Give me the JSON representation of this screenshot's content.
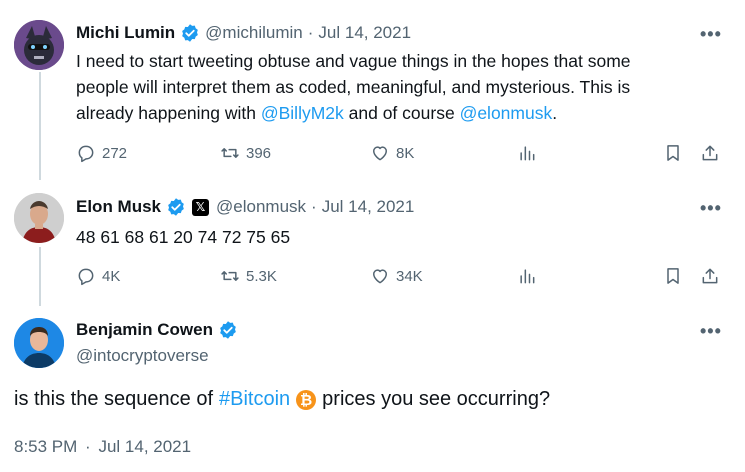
{
  "colors": {
    "accent": "#1d9bf0",
    "muted": "#536471",
    "text": "#0f1419",
    "bitcoin": "#f7931a"
  },
  "tweet1": {
    "name": "Michi Lumin",
    "handle": "@michilumin",
    "sep": "·",
    "date": "Jul 14, 2021",
    "text_a": "I need to start tweeting obtuse and vague things in the hopes that some",
    "text_b": "people will interpret them as coded, meaningful, and mysterious. This is",
    "text_c1": "already happening with ",
    "mention1": "@BillyM2k",
    "text_c2": " and of course ",
    "mention2": "@elonmusk",
    "text_c3": ".",
    "replies": "272",
    "retweets": "396",
    "likes": "8K"
  },
  "tweet2": {
    "name": "Elon Musk",
    "handle": "@elonmusk",
    "sep": "·",
    "date": "Jul 14, 2021",
    "text": "48 61 68 61 20 74 72 75 65",
    "replies": "4K",
    "retweets": "5.3K",
    "likes": "34K"
  },
  "tweet3": {
    "name": "Benjamin Cowen",
    "handle": "@intocryptoverse",
    "text_a": "is this the sequence of ",
    "hashtag": "#Bitcoin",
    "text_b": " prices you see occurring?",
    "time": "8:53 PM",
    "sep": "·",
    "date": "Jul 14, 2021"
  },
  "icons": {
    "more": "more-icon",
    "reply": "reply-icon",
    "retweet": "retweet-icon",
    "like": "heart-icon",
    "views": "analytics-icon",
    "bookmark": "bookmark-icon",
    "share": "share-icon",
    "verified": "verified-badge-icon",
    "x": "x-logo-icon",
    "bitcoin": "bitcoin-emoji-icon"
  },
  "x_logo_text": "𝕏"
}
